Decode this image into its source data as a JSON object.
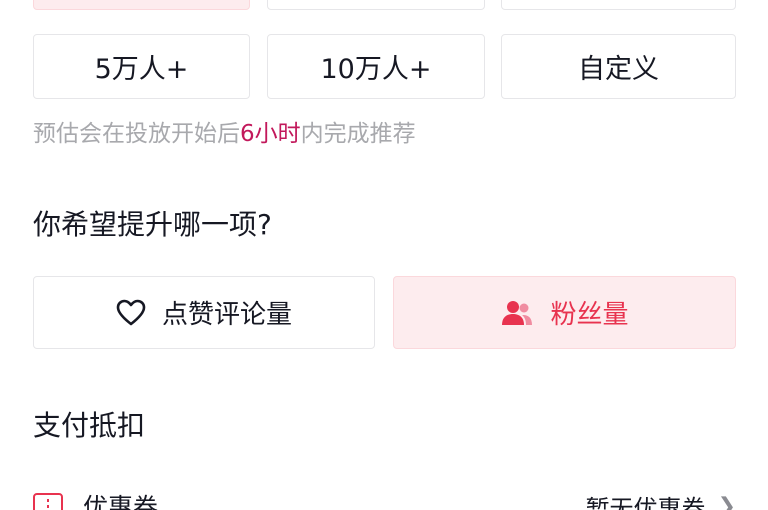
{
  "audience_options": {
    "row_top": [
      "",
      "",
      ""
    ],
    "row_mid": [
      "5万人+",
      "10万人+",
      "自定义"
    ]
  },
  "hint": {
    "prefix": "预估会在投放开始后",
    "highlight": "6小时",
    "suffix": "内完成推荐"
  },
  "goal_section": {
    "title": "你希望提升哪一项?",
    "options": [
      "点赞评论量",
      "粉丝量"
    ],
    "selected": "粉丝量"
  },
  "payment_section": {
    "title": "支付抵扣",
    "coupon_label": "优惠券",
    "coupon_status": "暂无优惠券"
  },
  "colors": {
    "accent": "#e8334f",
    "highlight": "#c2185b",
    "selected_bg": "#fdecee",
    "border": "#e6e6e9",
    "muted_text": "#a8a9ad"
  }
}
